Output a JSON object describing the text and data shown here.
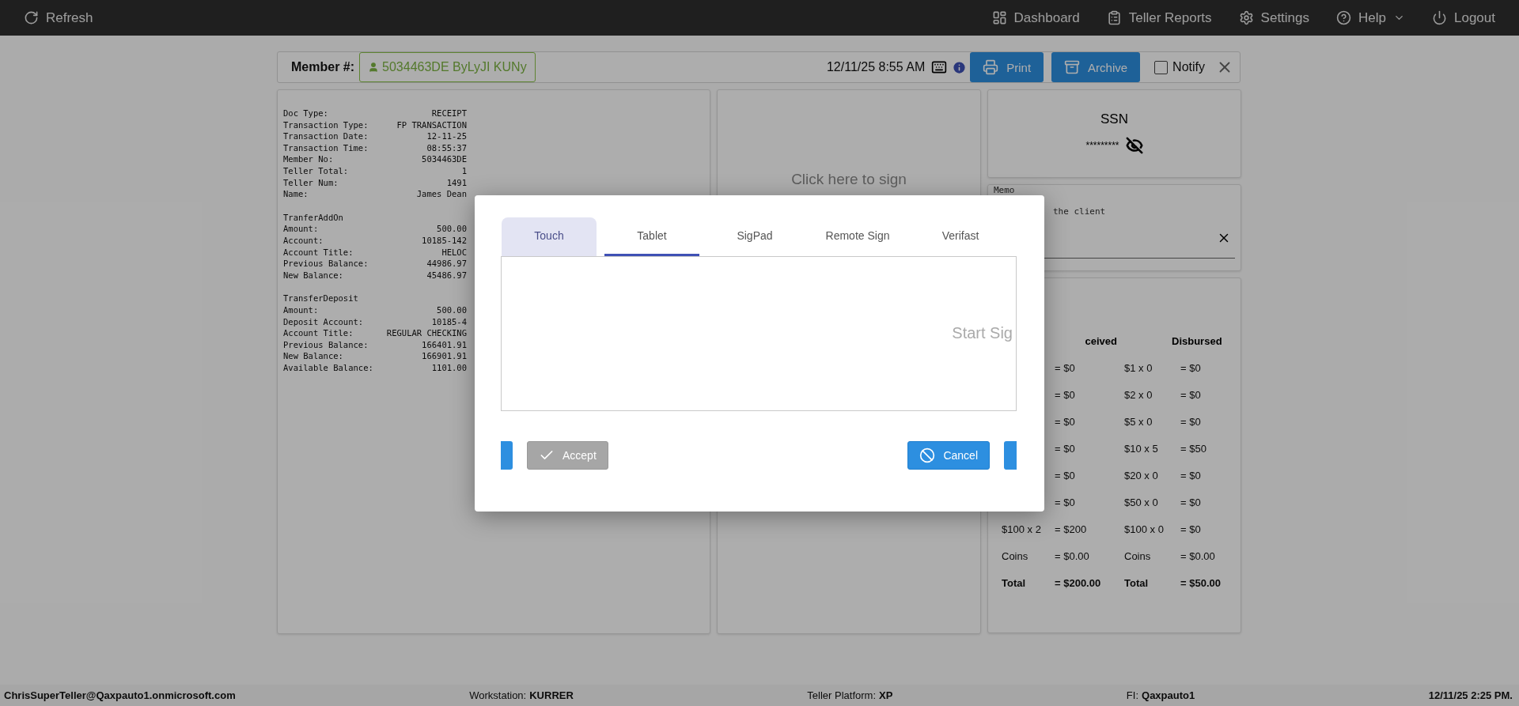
{
  "topbar": {
    "left": [
      {
        "kind": "refresh",
        "label": "Refresh"
      }
    ],
    "right": [
      {
        "kind": "dashboard",
        "label": "Dashboard"
      },
      {
        "kind": "reports",
        "label": "Teller Reports"
      },
      {
        "kind": "settings",
        "label": "Settings"
      },
      {
        "kind": "help",
        "label": "Help"
      },
      {
        "kind": "logout",
        "label": "Logout"
      }
    ]
  },
  "member_bar": {
    "label": "Member #:",
    "member": "5034463DE ByLyJI KUNy",
    "datetime": "12/11/25 8:55 AM",
    "print": "Print",
    "archive": "Archive",
    "notify": {
      "label": "Notify",
      "checked": false
    }
  },
  "receipt": [
    [
      [
        "Doc Type:",
        "RECEIPT"
      ],
      [
        "Transaction Type:",
        "FP TRANSACTION"
      ],
      [
        "Transaction Date:",
        "12-11-25"
      ],
      [
        "Transaction Time:",
        "08:55:37"
      ],
      [
        "Member No:",
        "5034463DE"
      ],
      [
        "Teller Total:",
        "1"
      ],
      [
        "Teller Num:",
        "1491"
      ],
      [
        "Name:",
        "James Dean"
      ]
    ],
    [
      [
        "TranferAddOn"
      ],
      [
        "Amount:",
        "500.00"
      ],
      [
        "Account:",
        "10185-142"
      ],
      [
        "Account Title:",
        "HELOC"
      ],
      [
        "Previous Balance:",
        "44986.97"
      ],
      [
        "New Balance:",
        "45486.97"
      ]
    ],
    [
      [
        "TransferDeposit"
      ],
      [
        "Amount:",
        "500.00"
      ],
      [
        "Deposit Account:",
        "10185-4"
      ],
      [
        "Account Title:",
        "REGULAR CHECKING"
      ],
      [
        "Previous Balance:",
        "166401.91"
      ],
      [
        "New Balance:",
        "166901.91"
      ],
      [
        "Available Balance:",
        "1101.00"
      ]
    ]
  ],
  "signature_panel": {
    "prompt": "Click here to sign"
  },
  "ssn": {
    "title": "SSN",
    "value": "*********"
  },
  "memo": {
    "label": "Memo",
    "value": "the client"
  },
  "cash": {
    "received_header": "ceived",
    "disbursed_header": "Disbursed",
    "rows": [
      {
        "received": {
          "value": "= $0"
        },
        "disbursed": {
          "label": "$1 x 0",
          "value": "= $0"
        }
      },
      {
        "received": {
          "value": "= $0"
        },
        "disbursed": {
          "label": "$2 x 0",
          "value": "= $0"
        }
      },
      {
        "received": {
          "value": "= $0"
        },
        "disbursed": {
          "label": "$5 x 0",
          "value": "= $0"
        }
      },
      {
        "received": {
          "value": "= $0"
        },
        "disbursed": {
          "label": "$10 x 5",
          "value": "= $50"
        }
      },
      {
        "received": {
          "value": "= $0"
        },
        "disbursed": {
          "label": "$20 x 0",
          "value": "= $0"
        }
      },
      {
        "received": {
          "value": "= $0"
        },
        "disbursed": {
          "label": "$50 x 0",
          "value": "= $0"
        }
      },
      {
        "received": {
          "label": "$100 x 2",
          "value": "= $200"
        },
        "disbursed": {
          "label": "$100 x 0",
          "value": "= $0"
        }
      },
      {
        "received": {
          "label": "Coins",
          "value": "= $0.00"
        },
        "disbursed": {
          "label": "Coins",
          "value": "= $0.00"
        }
      },
      {
        "kind": "total",
        "received": {
          "label": "Total",
          "value": "= $200.00"
        },
        "disbursed": {
          "label": "Total",
          "value": "= $50.00"
        }
      }
    ]
  },
  "dialog": {
    "tabs": [
      {
        "label": "Touch",
        "selected": false,
        "highlighted": true
      },
      {
        "label": "Tablet",
        "selected": true,
        "highlighted": false
      },
      {
        "label": "SigPad",
        "selected": false,
        "highlighted": false
      },
      {
        "label": "Remote Sign",
        "selected": false,
        "highlighted": false
      },
      {
        "label": "Verifast",
        "selected": false,
        "highlighted": false
      }
    ],
    "pad_text": "Start Sig",
    "accept": {
      "label": "Accept",
      "disabled": true
    },
    "cancel": {
      "label": "Cancel",
      "disabled": false
    }
  },
  "status_bar": {
    "user": "ChrisSuperTeller@Qaxpauto1.onmicrosoft.com",
    "fields": [
      {
        "label": "Workstation:",
        "value": "KURRER"
      },
      {
        "label": "Teller Platform:",
        "value": "XP"
      },
      {
        "label": "FI:",
        "value": "Qaxpauto1"
      }
    ],
    "time": "12/11/25 2:25 PM."
  }
}
